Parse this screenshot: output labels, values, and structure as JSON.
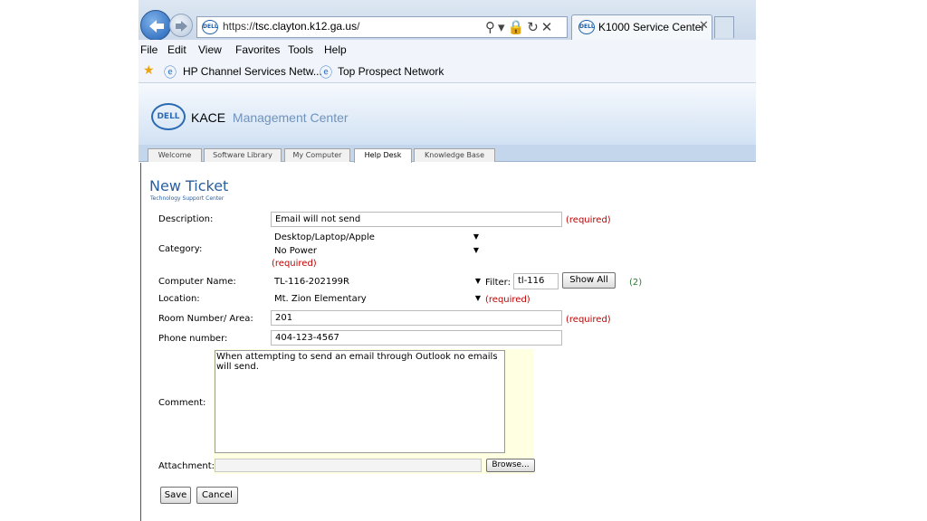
{
  "browser": {
    "url_prefix": "https://",
    "url_host": "tsc.clayton.k12.ga.us",
    "url_suffix": "/",
    "tab_title": "K1000 Service Center",
    "site_icon_text": "DELL",
    "menu": [
      "File",
      "Edit",
      "View",
      "Favorites",
      "Tools",
      "Help"
    ],
    "favorites": [
      "HP Channel Services Netw...",
      "Top Prospect Network"
    ]
  },
  "kace": {
    "logo_text": "DELL",
    "brand": "KACE",
    "title": "Management Center",
    "tabs": [
      "Welcome",
      "Software Library",
      "My Computer",
      "Help Desk",
      "Knowledge Base"
    ],
    "active_tab": "Help Desk"
  },
  "form": {
    "title": "New Ticket",
    "subtitle": "Technology Support Center",
    "description_label": "Description:",
    "description_value": "Email will not send",
    "required_text": "(required)",
    "category_label": "Category:",
    "category_value": "Desktop/Laptop/Apple",
    "subcategory_value": "No Power",
    "computer_name_label": "Computer Name:",
    "computer_name_value": "TL-116-202199R",
    "filter_label": "Filter:",
    "filter_value": "tl-116",
    "show_all_label": "Show All",
    "match_count": "(2)",
    "location_label": "Location:",
    "location_value": "Mt. Zion Elementary",
    "room_label": "Room Number/ Area:",
    "room_value": "201",
    "phone_label": "Phone number:",
    "phone_value": "404-123-4567",
    "comment_label": "Comment:",
    "comment_value": "When attempting to send an email through Outlook no emails\nwill send.",
    "attachment_label": "Attachment:",
    "browse_label": "Browse...",
    "save_label": "Save",
    "cancel_label": "Cancel"
  }
}
